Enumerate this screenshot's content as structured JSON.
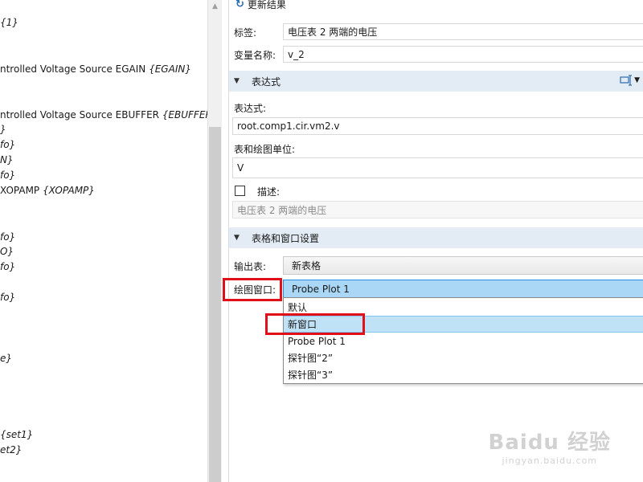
{
  "left_tree": {
    "lines": [
      {
        "text": "",
        "tag": "{1}"
      },
      {
        "text": "ntrolled Voltage Source EGAIN ",
        "tag": "{EGAIN}"
      },
      {
        "text": "ntrolled Voltage Source EBUFFER ",
        "tag": "{EBUFFER}"
      },
      {
        "text": "",
        "tag": "}"
      },
      {
        "text": "",
        "tag": "fo}"
      },
      {
        "text": "",
        "tag": "N}"
      },
      {
        "text": "",
        "tag": "fo}"
      },
      {
        "text": " XOPAMP ",
        "tag": "{XOPAMP}"
      },
      {
        "text": "",
        "tag": "fo}"
      },
      {
        "text": "",
        "tag": "O}"
      },
      {
        "text": "",
        "tag": "fo}"
      },
      {
        "text": "",
        "tag": "fo}"
      },
      {
        "text": "",
        "tag": "e}"
      },
      {
        "text": "",
        "tag": "{set1}"
      },
      {
        "text": "",
        "tag": "et2}"
      }
    ]
  },
  "toolbar": {
    "refresh_label": "更新结果"
  },
  "fields": {
    "label_label": "标签:",
    "label_value": "电压表 2 两端的电压",
    "varname_label": "变量名称:",
    "varname_value": "v_2"
  },
  "expression_section": {
    "title": "表达式",
    "expr_label": "表达式:",
    "expr_value": "root.comp1.cir.vm2.v",
    "unit_label": "表和绘图单位:",
    "unit_value": "V",
    "desc_label": "描述:",
    "desc_value": "电压表 2 两端的电压"
  },
  "table_window_section": {
    "title": "表格和窗口设置",
    "output_label": "输出表:",
    "output_value": "新表格",
    "plot_window_label": "绘图窗口:",
    "plot_window_value": "Probe Plot 1",
    "options": [
      "默认",
      "新窗口",
      "Probe Plot 1",
      "探针图“2”",
      "探针图“3”"
    ]
  },
  "watermark": {
    "logo": "Baidu 经验",
    "url": "jingyan.baidu.com"
  },
  "colors": {
    "section_bg": "#e3ecf5",
    "highlight": "#a9d7f5",
    "annotation_red": "#e0101a"
  }
}
